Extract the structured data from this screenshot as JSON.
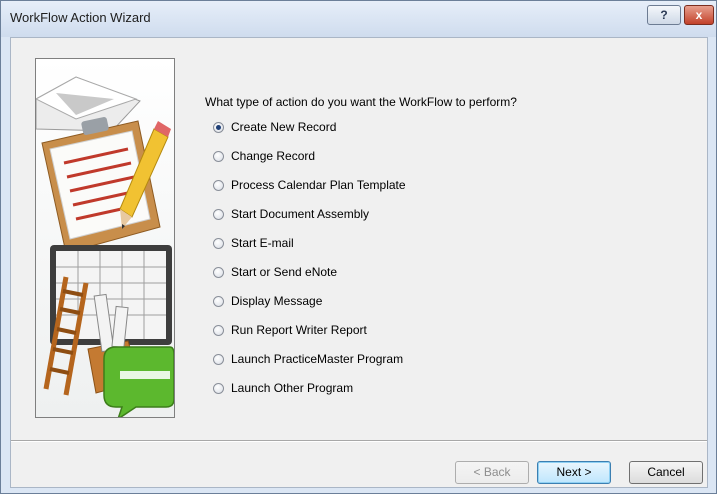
{
  "window": {
    "title": "WorkFlow Action Wizard",
    "help_label": "?",
    "close_label": "x"
  },
  "wizard": {
    "question": "What type of action do you want the WorkFlow to perform?",
    "options": [
      {
        "label": "Create New Record",
        "selected": true
      },
      {
        "label": "Change Record",
        "selected": false
      },
      {
        "label": "Process Calendar Plan Template",
        "selected": false
      },
      {
        "label": "Start Document Assembly",
        "selected": false
      },
      {
        "label": "Start E-mail",
        "selected": false
      },
      {
        "label": "Start or Send eNote",
        "selected": false
      },
      {
        "label": "Display Message",
        "selected": false
      },
      {
        "label": "Run Report Writer Report",
        "selected": false
      },
      {
        "label": "Launch PracticeMaster Program",
        "selected": false
      },
      {
        "label": "Launch Other Program",
        "selected": false
      }
    ]
  },
  "buttons": {
    "back": "< Back",
    "next": "Next >",
    "cancel": "Cancel",
    "back_enabled": false
  },
  "illustration": {
    "icons": [
      "envelope-icon",
      "clipboard-icon",
      "pencil-icon",
      "calendar-board-icon",
      "ladder-icon",
      "box-icon",
      "speech-bubble-icon"
    ]
  }
}
